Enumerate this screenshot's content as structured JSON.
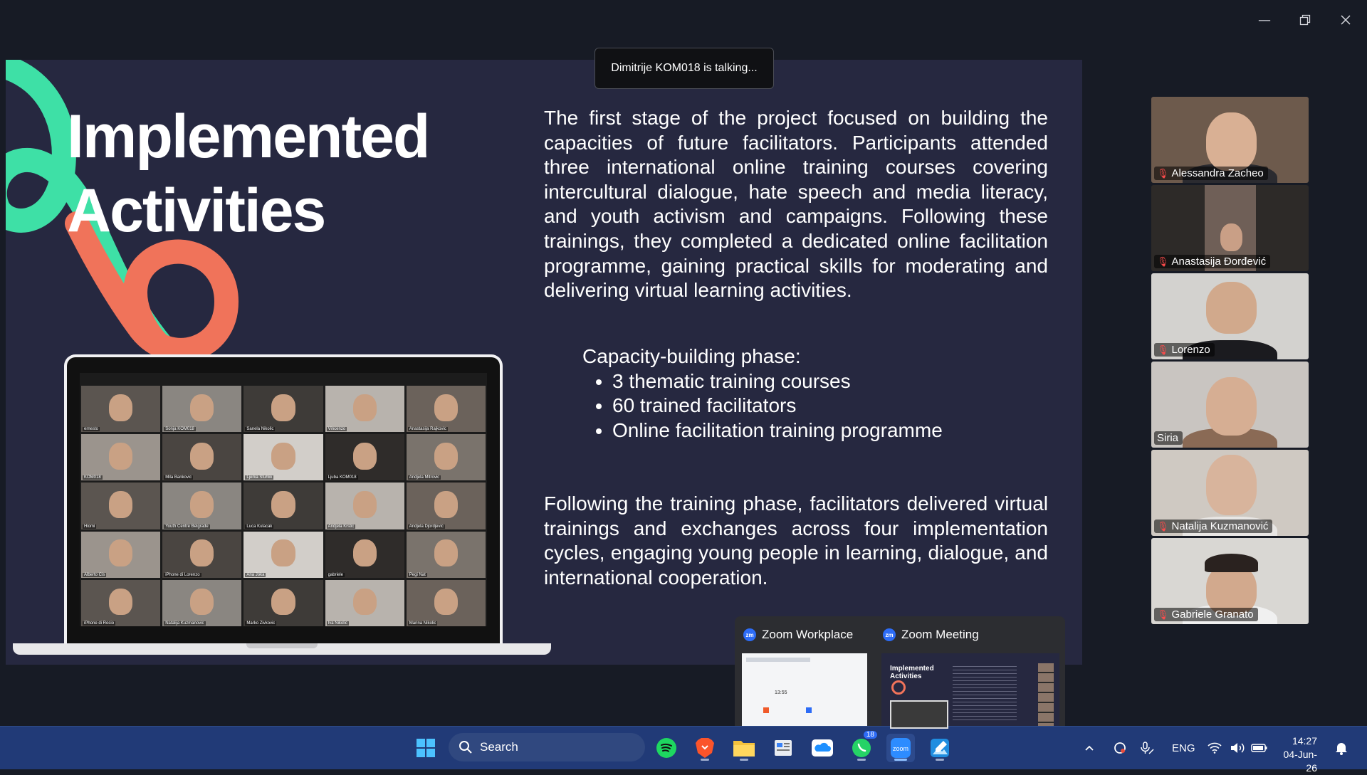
{
  "window": {
    "minimize_icon": "minimize-icon",
    "restore_icon": "restore-icon",
    "close_icon": "close-icon"
  },
  "toast": {
    "text": "Dimitrije KOM018 is talking..."
  },
  "slide": {
    "title_line1": "Implemented",
    "title_line2": "Activities",
    "paragraph1": "The first stage of the project focused on building the capacities of future facilitators. Participants attended three international online training courses covering intercultural dialogue, hate speech and media literacy, and youth activism and campaigns. Following these trainings, they completed a dedicated online facilitation programme, gaining practical skills for moderating and delivering virtual learning activities.",
    "phase_heading": "Capacity-building phase:",
    "phase_items": [
      "3 thematic training courses",
      "60 trained facilitators",
      "Online facilitation training programme"
    ],
    "paragraph2": "Following the training phase, facilitators delivered virtual trainings and exchanges across four implementation cycles, engaging young people in learning, dialogue, and international cooperation.",
    "colors": {
      "background": "#262840",
      "mint": "#3ee0a6",
      "coral": "#f0735a"
    }
  },
  "laptop_grid": {
    "names": [
      "ernesto",
      "Sonja KOM018",
      "Sanela Nikolic",
      "Vincenzo",
      "Anastasija Rajkovic",
      "KOM018",
      "Mila Bankovic",
      "Ljerka Stuhlik",
      "Ljuba KOM018",
      "Andjela Mitrovic",
      "Hiomi",
      "Youth Centre Belgrade",
      "Luca Kulacak",
      "Andjela Krstic",
      "Andjela Djordjevic",
      "Alberto Cis",
      "iPhone di Lorenzo",
      "Ana Joka",
      "gabriele",
      "Pegi Nat",
      "iPhone di Rocio",
      "Natalija Kuzmanovic",
      "Marko Zivkovic",
      "Iva Nikolic",
      "Marina Nikolic"
    ]
  },
  "participants": [
    {
      "name": "Alessandra Zacheo",
      "muted": true
    },
    {
      "name": "Anastasija Đorđević",
      "muted": true
    },
    {
      "name": "Lorenzo",
      "muted": true
    },
    {
      "name": "Siria",
      "muted": false
    },
    {
      "name": "Natalija Kuzmanović",
      "muted": true
    },
    {
      "name": "Gabriele Granato",
      "muted": true
    }
  ],
  "preview": {
    "items": [
      {
        "app": "Zoom Workplace",
        "logo": "zm"
      },
      {
        "app": "Zoom Meeting",
        "logo": "zm"
      }
    ],
    "mini_title": "Implemented Activities",
    "mini_time": "13:55"
  },
  "taskbar": {
    "search_label": "Search",
    "whatsapp_badge": "18",
    "language": "ENG",
    "time": "14:27",
    "date": "04-Jun-26",
    "icons": [
      "start-icon",
      "search-icon",
      "spotify-icon",
      "brave-icon",
      "file-explorer-icon",
      "app-icon",
      "onedrive-icon",
      "whatsapp-icon",
      "zoom-icon",
      "photo-app-icon",
      "chevron-up-icon",
      "sync-icon",
      "mic-icon",
      "wifi-icon",
      "volume-icon",
      "battery-icon",
      "notification-icon"
    ]
  }
}
